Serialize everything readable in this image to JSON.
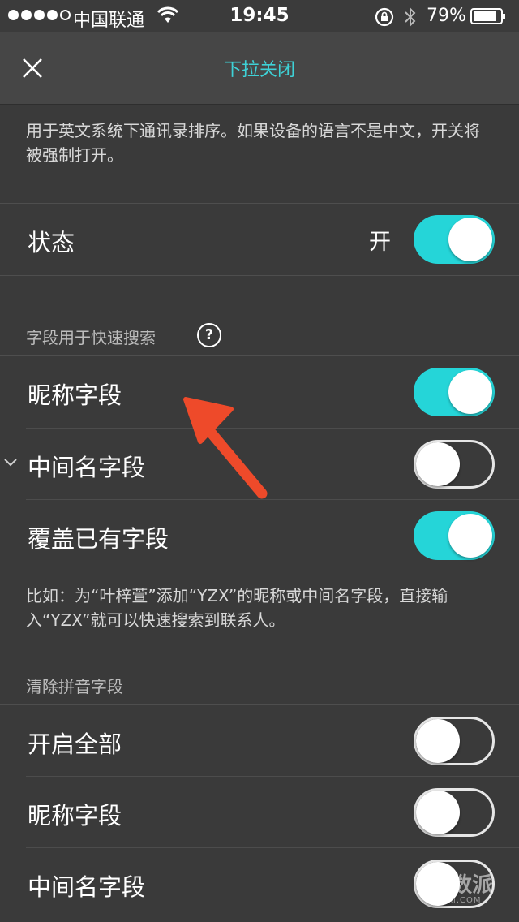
{
  "status_bar": {
    "carrier": "中国联通",
    "time": "19:45",
    "battery": "79%"
  },
  "nav": {
    "title": "下拉关闭"
  },
  "intro": {
    "description": "用于英文系统下通讯录排序。如果设备的语言不是中文，开关将被强制打开。"
  },
  "status_row": {
    "label": "状态",
    "value": "开",
    "on": true
  },
  "quick_search": {
    "header": "字段用于快速搜索",
    "help_symbol": "?",
    "items": [
      {
        "label": "昵称字段",
        "on": true
      },
      {
        "label": "中间名字段",
        "on": false
      },
      {
        "label": "覆盖已有字段",
        "on": true
      }
    ],
    "footer": "比如：为“叶梓萱”添加“YZX”的昵称或中间名字段，直接输入“YZX”就可以快速搜索到联系人。"
  },
  "clear_pinyin": {
    "header": "清除拼音字段",
    "items": [
      {
        "label": "开启全部",
        "on": false
      },
      {
        "label": "昵称字段",
        "on": false
      },
      {
        "label": "中间名字段",
        "on": false
      }
    ]
  },
  "watermark": {
    "text": "少数派",
    "sub": "SSPAI.COM"
  },
  "colors": {
    "accent": "#25d5d8",
    "title": "#3ed2d7",
    "arrow": "#ee4a2a",
    "background": "#3a3a3a"
  }
}
